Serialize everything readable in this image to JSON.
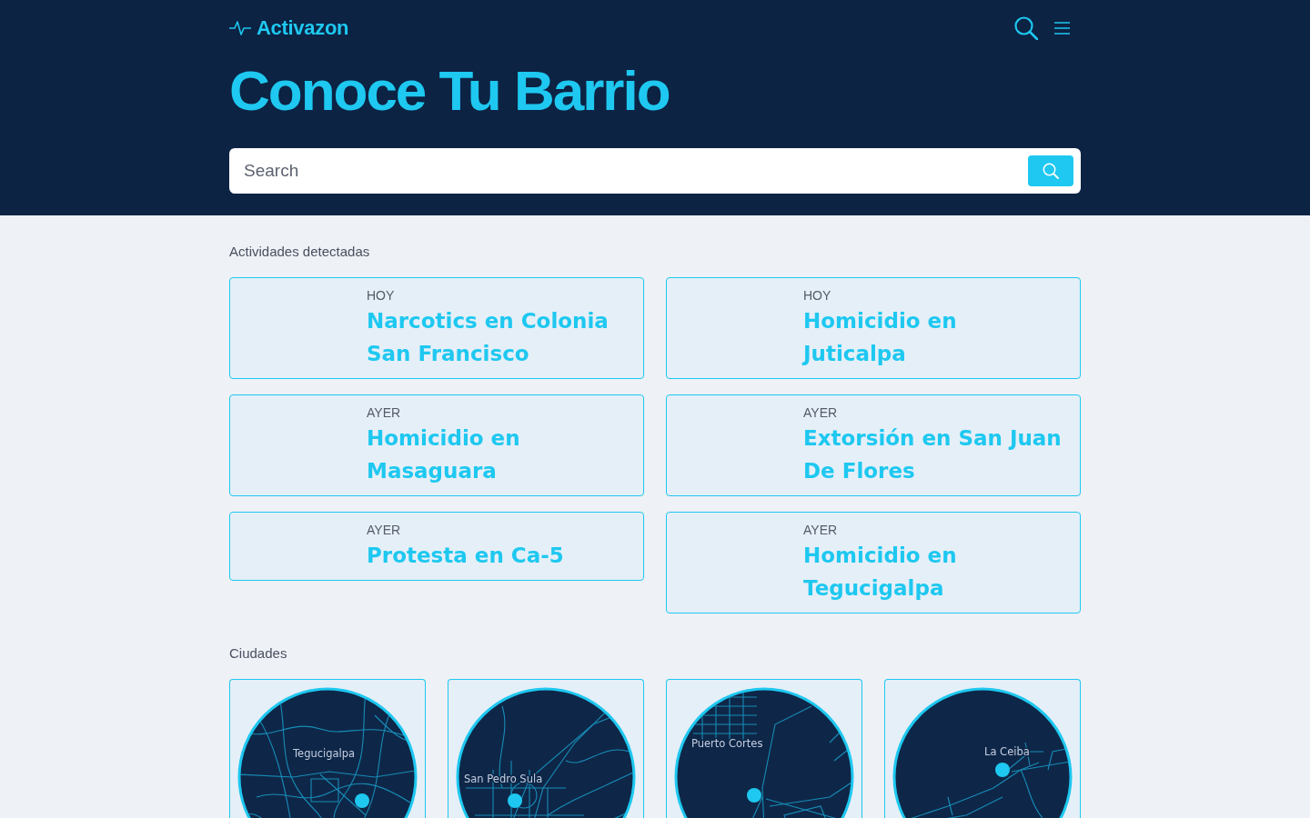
{
  "header": {
    "logo": "Activazon",
    "title": "Conoce Tu Barrio",
    "search": {
      "placeholder": "Search"
    }
  },
  "activities": {
    "heading": "Actividades detectadas",
    "items": [
      {
        "day": "HOY",
        "title": "Narcotics en Colonia San Francisco"
      },
      {
        "day": "HOY",
        "title": "Homicidio en Juticalpa"
      },
      {
        "day": "AYER",
        "title": "Homicidio en Masaguara"
      },
      {
        "day": "AYER",
        "title": "Extorsión en San Juan De Flores"
      },
      {
        "day": "AYER",
        "title": "Protesta en Ca-5"
      },
      {
        "day": "AYER",
        "title": "Homicidio en Tegucigalpa"
      }
    ]
  },
  "cities": {
    "heading": "Ciudades",
    "items": [
      {
        "label": "Tegucigalpa"
      },
      {
        "label": "San Pedro Sula"
      },
      {
        "label": "Puerto Cortes"
      },
      {
        "label": "La Ceiba"
      }
    ]
  }
}
